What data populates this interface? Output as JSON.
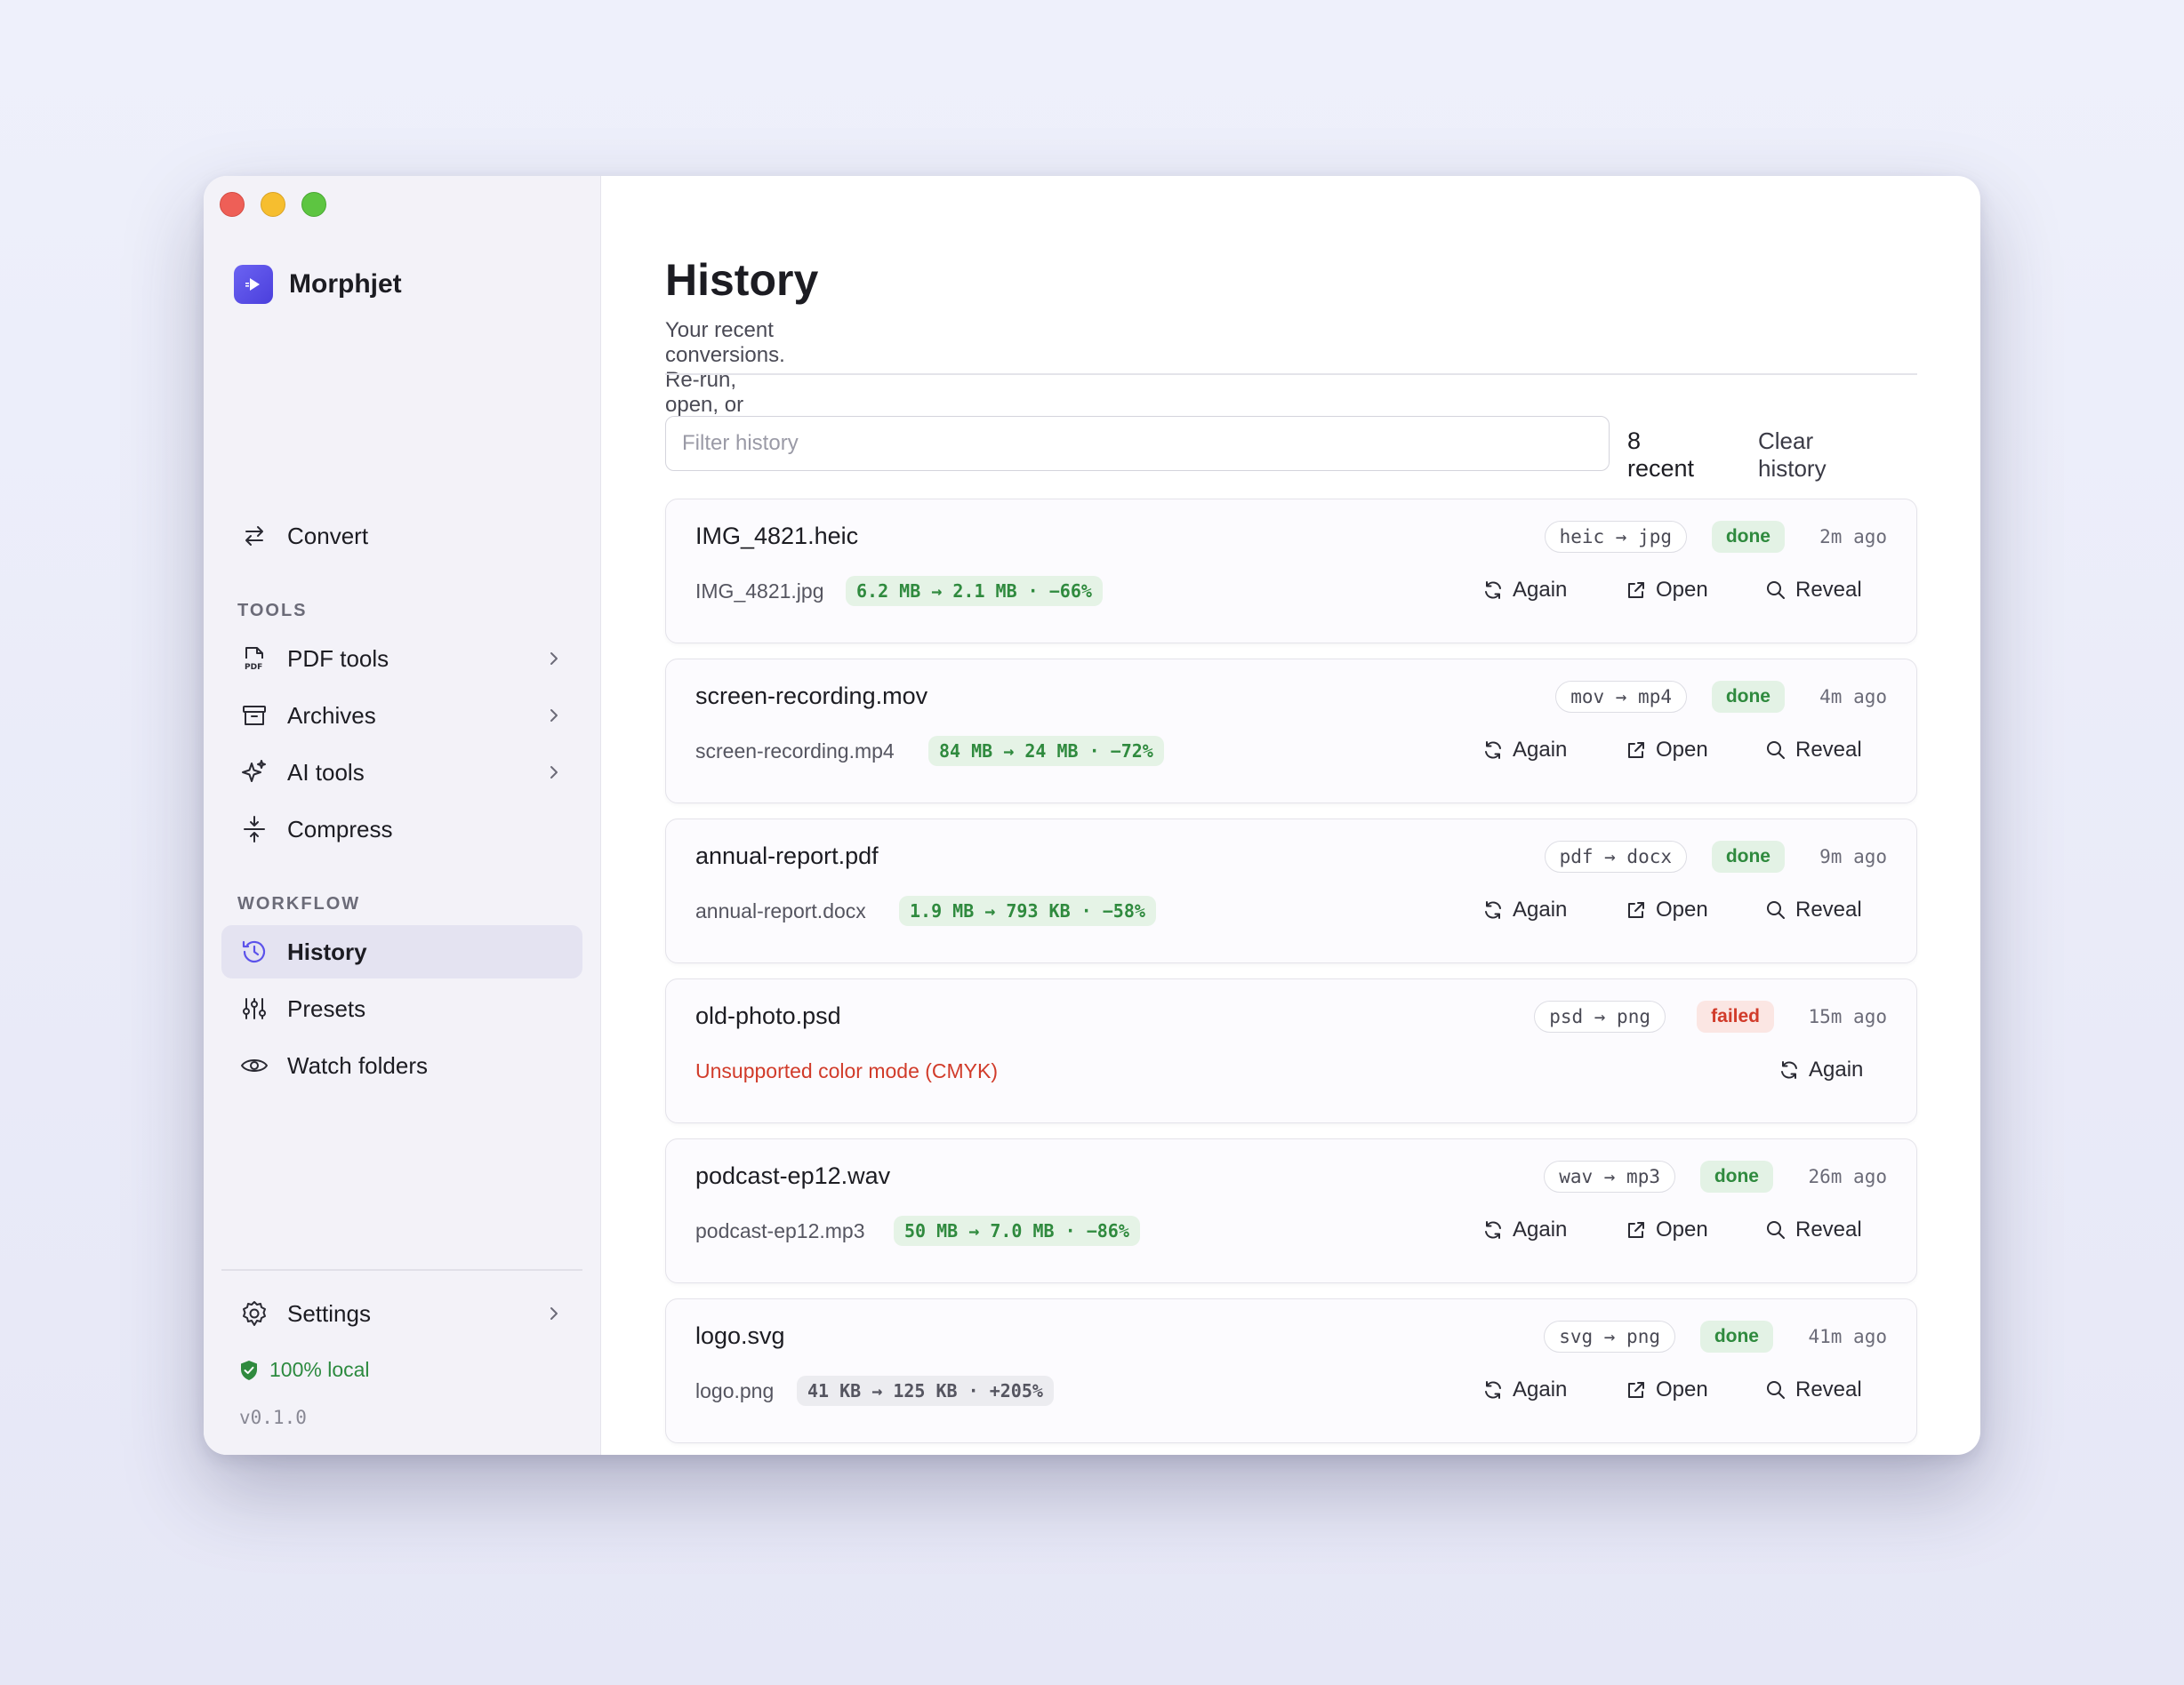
{
  "app": {
    "name": "Morphjet",
    "version": "v0.1.0",
    "local_label": "100% local"
  },
  "sidebar": {
    "convert": "Convert",
    "tools_label": "TOOLS",
    "tools": [
      "PDF tools",
      "Archives",
      "AI tools",
      "Compress"
    ],
    "workflow_label": "WORKFLOW",
    "workflow": [
      "History",
      "Presets",
      "Watch folders"
    ],
    "settings": "Settings"
  },
  "page": {
    "title": "History",
    "subtitle": "Your recent conversions. Re-run, open, or reveal any of them.",
    "filter_placeholder": "Filter history",
    "recent_count": "8 recent",
    "clear_label": "Clear history"
  },
  "actions": {
    "again": "Again",
    "open": "Open",
    "reveal": "Reveal"
  },
  "history": [
    {
      "file": "IMG_4821.heic",
      "output": "IMG_4821.jpg",
      "size": "6.2 MB → 2.1 MB · −66%",
      "format": "heic → jpg",
      "status": "done",
      "time": "2m ago"
    },
    {
      "file": "screen-recording.mov",
      "output": "screen-recording.mp4",
      "size": "84 MB → 24 MB · −72%",
      "format": "mov → mp4",
      "status": "done",
      "time": "4m ago"
    },
    {
      "file": "annual-report.pdf",
      "output": "annual-report.docx",
      "size": "1.9 MB → 793 KB · −58%",
      "format": "pdf → docx",
      "status": "done",
      "time": "9m ago"
    },
    {
      "file": "old-photo.psd",
      "error": "Unsupported color mode (CMYK)",
      "format": "psd → png",
      "status": "failed",
      "time": "15m ago"
    },
    {
      "file": "podcast-ep12.wav",
      "output": "podcast-ep12.mp3",
      "size": "50 MB → 7.0 MB · −86%",
      "format": "wav → mp3",
      "status": "done",
      "time": "26m ago"
    },
    {
      "file": "logo.svg",
      "output": "logo.png",
      "size": "41 KB → 125 KB · +205%",
      "format": "svg → png",
      "status": "done",
      "time": "41m ago"
    }
  ],
  "colors": {
    "accent": "#5b52ea",
    "success": "#2f8a3e",
    "error": "#d13b2a"
  }
}
